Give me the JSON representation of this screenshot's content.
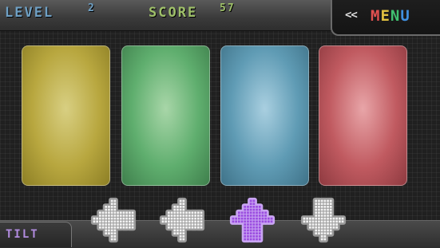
{
  "hud": {
    "level_label": "LEVEL",
    "level_value": "2",
    "score_label": "SCORE",
    "score_value": "57"
  },
  "menu": {
    "arrows": "<<",
    "letters": [
      "M",
      "E",
      "N",
      "U"
    ]
  },
  "pads": [
    {
      "name": "yellow",
      "color": "#b8a73f"
    },
    {
      "name": "green",
      "color": "#5fae6e"
    },
    {
      "name": "blue",
      "color": "#5f9bb4"
    },
    {
      "name": "red",
      "color": "#c05a60"
    }
  ],
  "tilt": {
    "label": "TILT"
  },
  "arrows": [
    {
      "direction": "left",
      "active": false
    },
    {
      "direction": "right",
      "active": false
    },
    {
      "direction": "up",
      "active": true,
      "active_color": "#9b4de0"
    },
    {
      "direction": "down",
      "active": false
    }
  ]
}
